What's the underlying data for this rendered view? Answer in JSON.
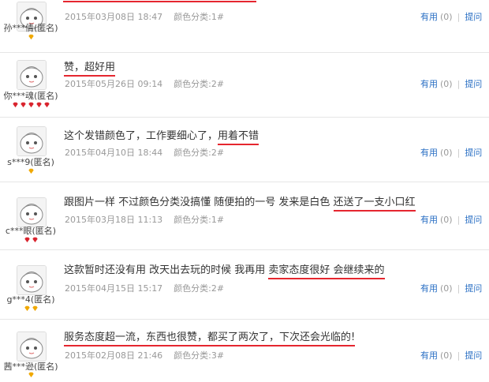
{
  "reviews": [
    {
      "username": "孙***倩(匿名)",
      "content_pre": "",
      "content_hl": "",
      "date": "2015年03月08日 18:47",
      "sku": "颜色分类:1#",
      "useful_label": "有用",
      "useful_count": "(0)",
      "ask_label": "提问",
      "rank": "gold",
      "rank_count": 1
    },
    {
      "username": "你***魂(匿名)",
      "content_pre": "",
      "content_hl": "赞，超好用",
      "date": "2015年05月26日 09:14",
      "sku": "颜色分类:2#",
      "useful_label": "有用",
      "useful_count": "(0)",
      "ask_label": "提问",
      "rank": "red",
      "rank_count": 5
    },
    {
      "username": "s***9(匿名)",
      "content_pre": "这个发错颜色了，工作要细心了，",
      "content_hl": "用着不错",
      "date": "2015年04月10日 18:44",
      "sku": "颜色分类:2#",
      "useful_label": "有用",
      "useful_count": "(0)",
      "ask_label": "提问",
      "rank": "gold",
      "rank_count": 1
    },
    {
      "username": "c***眼(匿名)",
      "content_pre": "跟图片一样 不过颜色分类没搞懂 随便拍的一号 发来是白色 ",
      "content_hl": "还送了一支小口红",
      "date": "2015年03月18日 11:13",
      "sku": "颜色分类:1#",
      "useful_label": "有用",
      "useful_count": "(0)",
      "ask_label": "提问",
      "rank": "red",
      "rank_count": 2
    },
    {
      "username": "g***4(匿名)",
      "content_pre": "这款暂时还没有用 改天出去玩的时候 我再用 ",
      "content_hl": "卖家态度很好 会继续来的",
      "date": "2015年04月15日 15:17",
      "sku": "颜色分类:2#",
      "useful_label": "有用",
      "useful_count": "(0)",
      "ask_label": "提问",
      "rank": "gold",
      "rank_count": 2
    },
    {
      "username": "茜***逊(匿名)",
      "content_pre": "",
      "content_hl": "服务态度超一流，东西也很赞，都买了两次了，下次还会光临的!",
      "date": "2015年02月08日 21:46",
      "sku": "颜色分类:3#",
      "useful_label": "有用",
      "useful_count": "(0)",
      "ask_label": "提问",
      "rank": "gold",
      "rank_count": 1
    }
  ],
  "colors": {
    "link": "#2a6fc4",
    "underline": "#e5262f",
    "meta": "#999999",
    "gem_gold": "#f0a800",
    "gem_red": "#d9232d"
  }
}
